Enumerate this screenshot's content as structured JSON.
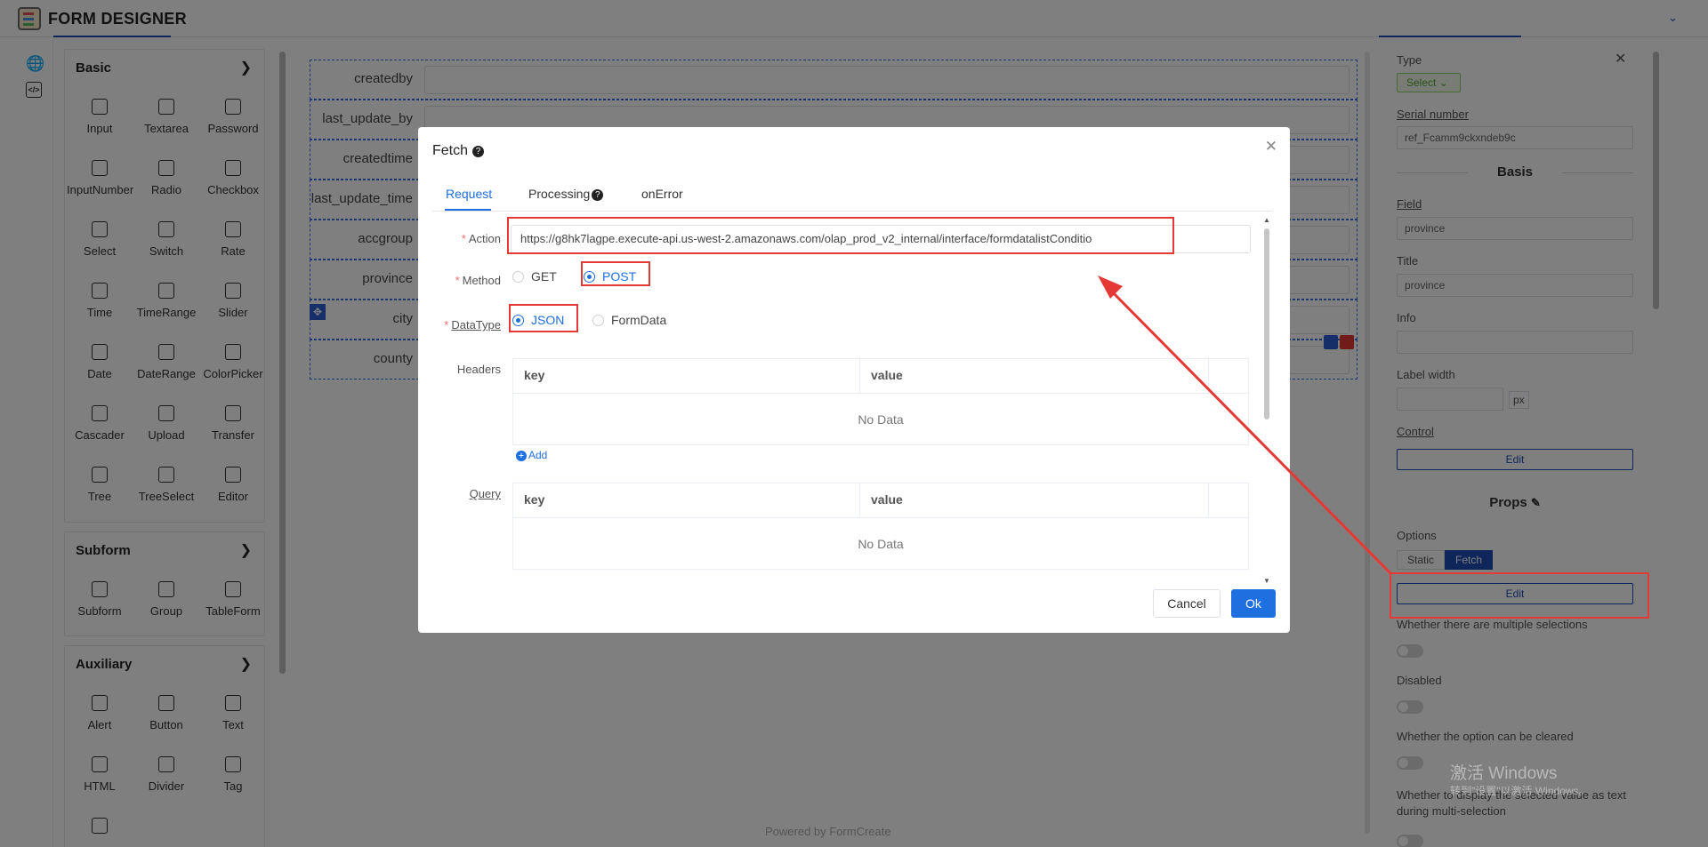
{
  "app": {
    "title": "FORM DESIGNER",
    "powered_by": "Powered by FormCreate"
  },
  "left_panel": {
    "groups": [
      {
        "title": "Basic",
        "items": [
          "Input",
          "Textarea",
          "Password",
          "InputNumber",
          "Radio",
          "Checkbox",
          "Select",
          "Switch",
          "Rate",
          "Time",
          "TimeRange",
          "Slider",
          "Date",
          "DateRange",
          "ColorPicker",
          "Cascader",
          "Upload",
          "Transfer",
          "Tree",
          "TreeSelect",
          "Editor"
        ]
      },
      {
        "title": "Subform",
        "items": [
          "Subform",
          "Group",
          "TableForm"
        ]
      },
      {
        "title": "Auxiliary",
        "items": [
          "Alert",
          "Button",
          "Text",
          "HTML",
          "Divider",
          "Tag",
          ""
        ]
      }
    ]
  },
  "canvas": {
    "rows": [
      {
        "label": "createdby"
      },
      {
        "label": "last_update_by"
      },
      {
        "label": "createdtime"
      },
      {
        "label": "last_update_time"
      },
      {
        "label": "accgroup"
      },
      {
        "label": "province"
      },
      {
        "label": "city"
      },
      {
        "label": "county"
      }
    ]
  },
  "right_panel": {
    "type_label": "Type",
    "type_value": "Select",
    "serial_label": "Serial number",
    "serial_value": "ref_Fcamm9ckxndeb9c",
    "basis_title": "Basis",
    "field_label": "Field",
    "field_value": "province",
    "title_label": "Title",
    "title_value": "province",
    "info_label": "Info",
    "label_width_label": "Label width",
    "label_width_unit": "px",
    "control_label": "Control",
    "edit_label": "Edit",
    "props_title": "Props",
    "options_label": "Options",
    "options_static": "Static",
    "options_fetch": "Fetch",
    "multiple_label": "Whether there are multiple selections",
    "disabled_label": "Disabled",
    "clearable_label": "Whether the option can be cleared",
    "display_text_label": "Whether to display the selected value as text during multi-selection"
  },
  "modal": {
    "title": "Fetch",
    "tabs": [
      "Request",
      "Processing",
      "onError"
    ],
    "active_tab": "Request",
    "action_label": "Action",
    "action_value": "https://g8hk7lagpe.execute-api.us-west-2.amazonaws.com/olap_prod_v2_internal/interface/formdatalistConditio",
    "method_label": "Method",
    "method_options": [
      "GET",
      "POST"
    ],
    "method_selected": "POST",
    "datatype_label": "DataType",
    "datatype_options": [
      "JSON",
      "FormData"
    ],
    "datatype_selected": "JSON",
    "headers_label": "Headers",
    "query_label": "Query",
    "col_key": "key",
    "col_value": "value",
    "no_data": "No Data",
    "add_label": "Add",
    "cancel_label": "Cancel",
    "ok_label": "Ok"
  },
  "watermark": {
    "line1": "激活 Windows",
    "line2": "转到\"设置\"以激活 Windows。"
  },
  "colors": {
    "accent": "#1e6fe0",
    "brand": "#1e4db7",
    "highlight": "#e53935"
  }
}
